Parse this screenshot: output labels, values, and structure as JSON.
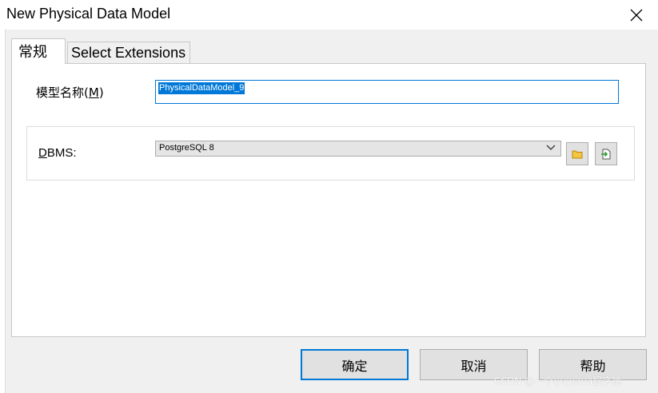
{
  "window": {
    "title": "New Physical Data Model"
  },
  "tabs": [
    {
      "label": "常规",
      "active": true
    },
    {
      "label": "Select Extensions",
      "active": false
    }
  ],
  "general": {
    "model_name_label_prefix": "模型名称(",
    "model_name_label_key": "M",
    "model_name_label_suffix": ")",
    "model_name_value": "PhysicalDataModel_9",
    "dbms_label_key": "D",
    "dbms_label_rest": "BMS:",
    "dbms_value": "PostgreSQL 8"
  },
  "buttons": {
    "ok": "确定",
    "cancel": "取消",
    "help": "帮助"
  },
  "watermark": "CSDN @一个小小java程序猿",
  "colors": {
    "accent": "#0078d7",
    "folder": "#f5c542",
    "import": "#2e9d2e"
  }
}
